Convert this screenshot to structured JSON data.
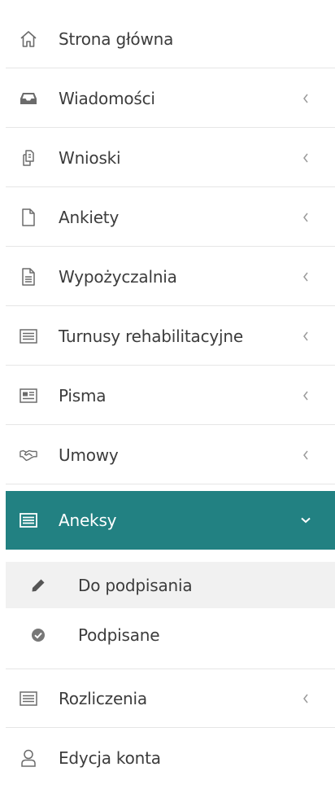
{
  "menu": {
    "items": [
      {
        "label": "Strona główna",
        "icon": "home-icon"
      },
      {
        "label": "Wiadomości",
        "icon": "inbox-icon"
      },
      {
        "label": "Wnioski",
        "icon": "documents-icon"
      },
      {
        "label": "Ankiety",
        "icon": "file-icon"
      },
      {
        "label": "Wypożyczalnia",
        "icon": "file-text-icon"
      },
      {
        "label": "Turnusy rehabilitacyjne",
        "icon": "list-icon"
      },
      {
        "label": "Pisma",
        "icon": "newspaper-icon"
      },
      {
        "label": "Umowy",
        "icon": "handshake-icon"
      },
      {
        "label": "Aneksy",
        "icon": "list-icon",
        "active": true
      },
      {
        "label": "Rozliczenia",
        "icon": "list-icon"
      },
      {
        "label": "Edycja konta",
        "icon": "user-icon"
      }
    ],
    "submenu": [
      {
        "label": "Do podpisania",
        "icon": "pencil-icon"
      },
      {
        "label": "Podpisane",
        "icon": "check-circle-icon"
      }
    ]
  },
  "colors": {
    "active_background": "#228182",
    "hover_background": "#f1f1f1",
    "text": "#3c3c3c",
    "icon": "#6b6b6b"
  }
}
